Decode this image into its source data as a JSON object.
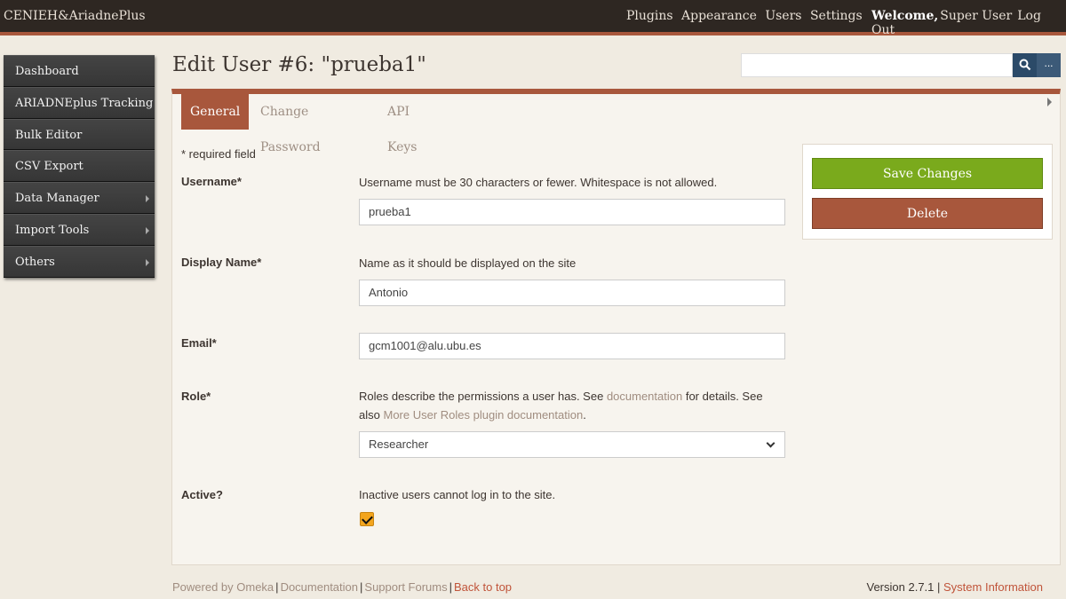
{
  "topbar": {
    "site_title": "CENIEH&AriadnePlus",
    "nav": [
      "Plugins",
      "Appearance",
      "Users",
      "Settings"
    ],
    "welcome": "Welcome,",
    "user_name": "Super User",
    "logout": "Log Out"
  },
  "sidebar": {
    "items": [
      {
        "label": "Dashboard",
        "has_arrow": false
      },
      {
        "label": "ARIADNEplus Tracking",
        "has_arrow": false
      },
      {
        "label": "Bulk Editor",
        "has_arrow": false
      },
      {
        "label": "CSV Export",
        "has_arrow": false
      },
      {
        "label": "Data Manager",
        "has_arrow": true
      },
      {
        "label": "Import Tools",
        "has_arrow": true
      },
      {
        "label": "Others",
        "has_arrow": true
      }
    ]
  },
  "page": {
    "title": "Edit User #6: \"prueba1\""
  },
  "search": {
    "search_icon": "search-icon",
    "more_label": "..."
  },
  "tabs": {
    "general": "General",
    "change_password": "Change Password",
    "api_keys": "API Keys"
  },
  "form": {
    "required_note": "* required field",
    "username": {
      "label": "Username*",
      "hint": "Username must be 30 characters or fewer. Whitespace is not allowed.",
      "value": "prueba1"
    },
    "display_name": {
      "label": "Display Name*",
      "hint": "Name as it should be displayed on the site",
      "value": "Antonio"
    },
    "email": {
      "label": "Email*",
      "value": "gcm1001@alu.ubu.es"
    },
    "role": {
      "label": "Role*",
      "hint_part1": "Roles describe the permissions a user has. See",
      "hint_link1": "documentation",
      "hint_part2": "for details. See also",
      "hint_link2": "More User Roles plugin documentation",
      "hint_part3": ".",
      "selected": "Researcher"
    },
    "active": {
      "label": "Active?",
      "hint": "Inactive users cannot log in to the site.",
      "checked": true
    }
  },
  "actions": {
    "save": "Save Changes",
    "delete": "Delete"
  },
  "footer": {
    "powered": "Powered by Omeka",
    "documentation": "Documentation",
    "forums": "Support Forums",
    "back_to_top": "Back to top",
    "version": "Version 2.7.1 |",
    "system_info": "System Information"
  },
  "colors": {
    "accent": "#a8573c",
    "topbar": "#2e2722",
    "save_green": "#7aaa1c",
    "checkbox": "#f3a51e"
  }
}
